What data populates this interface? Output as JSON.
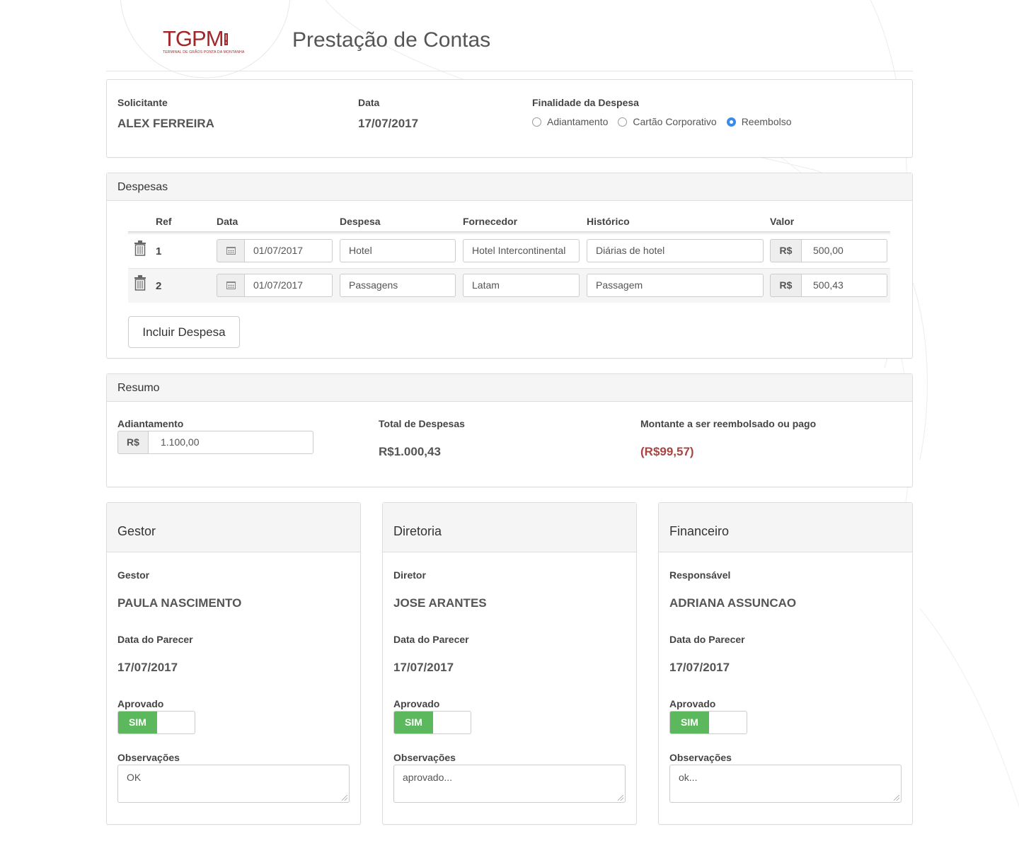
{
  "header": {
    "logo_text": "TGPM",
    "logo_subtext": "TERMINAL DE GRÃOS PONTA DA MONTANHA",
    "title": "Prestação de Contas",
    "brand_color": "#a3262a"
  },
  "request": {
    "solicitante_label": "Solicitante",
    "solicitante_value": "ALEX FERREIRA",
    "data_label": "Data",
    "data_value": "17/07/2017",
    "finalidade_label": "Finalidade da Despesa",
    "finalidade_options": [
      {
        "label": "Adiantamento",
        "selected": false
      },
      {
        "label": "Cartão Corporativo",
        "selected": false
      },
      {
        "label": "Reembolso",
        "selected": true
      }
    ]
  },
  "despesas": {
    "title": "Despesas",
    "columns": [
      "Ref",
      "Data",
      "Despesa",
      "Fornecedor",
      "Histórico",
      "Valor"
    ],
    "currency": "R$",
    "rows": [
      {
        "ref": "1",
        "data": "01/07/2017",
        "despesa": "Hotel",
        "fornecedor": "Hotel Intercontinental",
        "historico": "Diárias de hotel",
        "valor": "500,00"
      },
      {
        "ref": "2",
        "data": "01/07/2017",
        "despesa": "Passagens",
        "fornecedor": "Latam",
        "historico": "Passagem",
        "valor": "500,43"
      }
    ],
    "add_button": "Incluir Despesa"
  },
  "resumo": {
    "title": "Resumo",
    "adiantamento_label": "Adiantamento",
    "currency": "R$",
    "adiantamento_value": "1.100,00",
    "total_label": "Total de Despesas",
    "total_value": "R$1.000,43",
    "montante_label": "Montante a ser reembolsado ou pago",
    "montante_value": "(R$99,57)",
    "negative_color": "#a94442"
  },
  "approvals": [
    {
      "title": "Gestor",
      "person_label": "Gestor",
      "person": "PAULA NASCIMENTO",
      "date_label": "Data do Parecer",
      "date": "17/07/2017",
      "approved_label": "Aprovado",
      "toggle_on": "SIM",
      "obs_label": "Observações",
      "obs": "OK"
    },
    {
      "title": "Diretoria",
      "person_label": "Diretor",
      "person": "JOSE ARANTES",
      "date_label": "Data do Parecer",
      "date": "17/07/2017",
      "approved_label": "Aprovado",
      "toggle_on": "SIM",
      "obs_label": "Observações",
      "obs": "aprovado..."
    },
    {
      "title": "Financeiro",
      "person_label": "Responsável",
      "person": "ADRIANA ASSUNCAO",
      "date_label": "Data do Parecer",
      "date": "17/07/2017",
      "approved_label": "Aprovado",
      "toggle_on": "SIM",
      "obs_label": "Observações",
      "obs": "ok..."
    }
  ],
  "colors": {
    "toggle_on": "#5cb85c",
    "radio_selected": "#3b8bea"
  }
}
